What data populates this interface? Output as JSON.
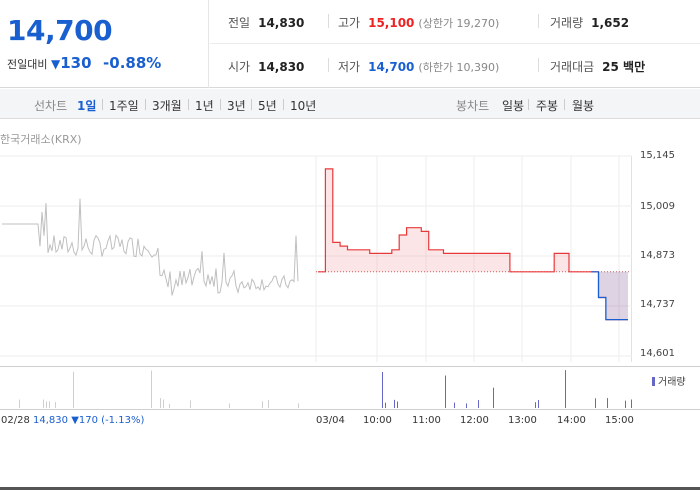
{
  "summary": {
    "price": "14,700",
    "change_label": "전일대비",
    "change_icon": "down-triangle-icon",
    "change_value": "130",
    "change_pct": "-0.88%"
  },
  "stats": {
    "prev_close": {
      "label": "전일",
      "value": "14,830"
    },
    "high": {
      "label": "고가",
      "value": "15,100",
      "sub": "(상한가 19,270)"
    },
    "volume": {
      "label": "거래량",
      "value": "1,652"
    },
    "open": {
      "label": "시가",
      "value": "14,830"
    },
    "low": {
      "label": "저가",
      "value": "14,700",
      "sub": "(하한가 10,390)"
    },
    "amount": {
      "label": "거래대금",
      "value": "25 백만"
    }
  },
  "toolbar": {
    "line_label": "선차트",
    "line_periods": [
      "1일",
      "1주일",
      "3개월",
      "1년",
      "3년",
      "5년",
      "10년"
    ],
    "active_period": "1일",
    "candle_label": "봉차트",
    "candle_periods": [
      "일봉",
      "주봉",
      "월봉"
    ]
  },
  "chart": {
    "source": "한국거래소(KRX)",
    "y_ticks": [
      "15,145",
      "15,009",
      "14,873",
      "14,737",
      "14,601"
    ],
    "x_ticks": [
      "03/04",
      "10:00",
      "11:00",
      "12:00",
      "13:00",
      "14:00",
      "15:00"
    ],
    "volume_legend": "거래량",
    "prev_day": {
      "date": "02/28",
      "price": "14,830",
      "change": "▼170",
      "pct": "(-1.13%)"
    },
    "colors": {
      "up": "#e8393a",
      "down": "#1a5fd0",
      "prev": "#bfbfbf",
      "volume": "#6767c8"
    }
  },
  "chart_data": {
    "type": "line",
    "title": "",
    "ylabel": "",
    "ylim": [
      14601,
      15145
    ],
    "reference_line": 14830,
    "series": [
      {
        "values": [
          14830,
          15110,
          14910,
          14900,
          14890,
          14890,
          14890,
          14880,
          14880,
          14880,
          14890,
          14930,
          14950,
          14950,
          14940,
          14890,
          14890,
          14880,
          14880,
          14880,
          14880,
          14880,
          14880,
          14880,
          14880,
          14880,
          14830,
          14830,
          14830,
          14830,
          14830,
          14830,
          14880,
          14880,
          14830,
          14830,
          14830,
          14830,
          14760,
          14700,
          14700,
          14700,
          14700
        ]
      }
    ]
  }
}
